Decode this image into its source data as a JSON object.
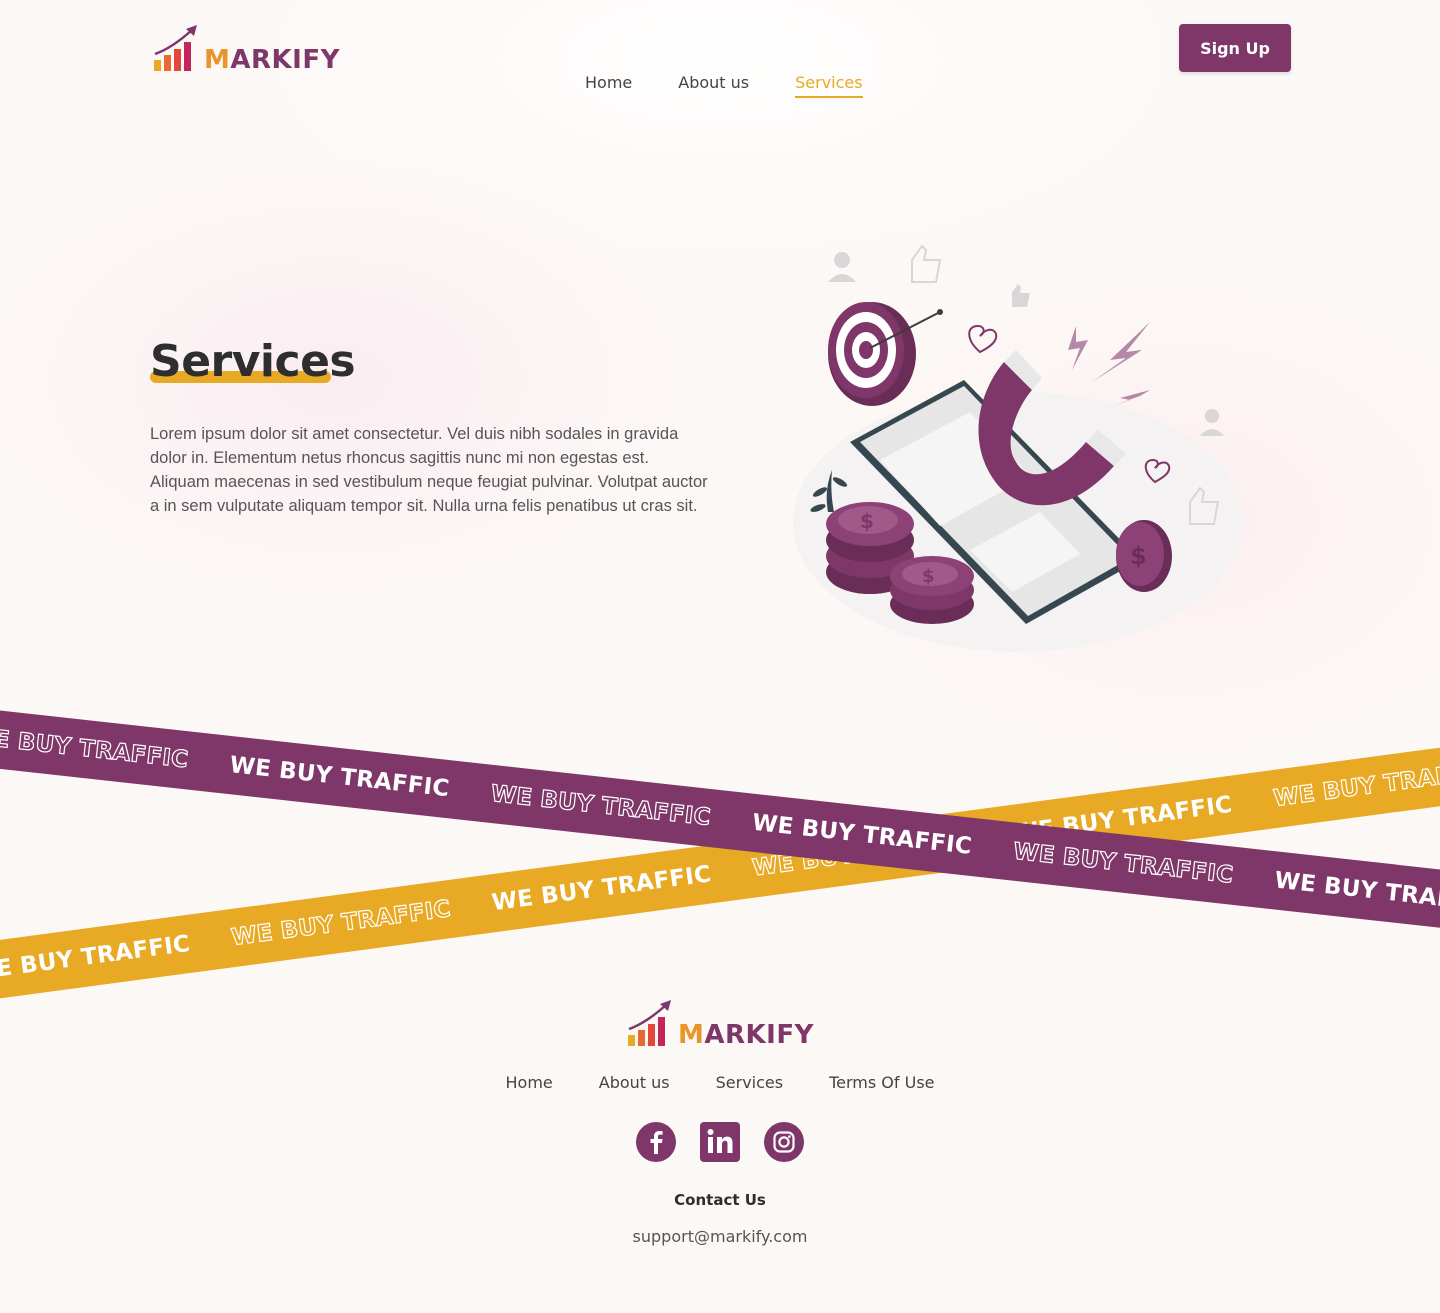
{
  "brand": {
    "name_first": "M",
    "name_rest": "ARKIFY"
  },
  "header": {
    "nav": [
      {
        "label": "Home"
      },
      {
        "label": "About us"
      },
      {
        "label": "Services",
        "active": true
      }
    ],
    "signup_label": "Sign Up"
  },
  "hero": {
    "title": "Services",
    "description": "Lorem ipsum dolor sit amet consectetur. Vel duis nibh sodales in gravida dolor in. Elementum netus rhoncus sagittis nunc mi non egestas est. Aliquam maecenas in sed vestibulum neque feugiat pulvinar. Volutpat auctor a in sem vulputate aliquam tempor sit. Nulla urna felis penatibus ut cras sit.",
    "illustration": "magnet-attracting-coins-phone-illustration"
  },
  "ribbons": {
    "text": "WE BUY TRAFFIC"
  },
  "footer": {
    "nav": [
      {
        "label": "Home"
      },
      {
        "label": "About us"
      },
      {
        "label": "Services"
      },
      {
        "label": "Terms Of Use"
      }
    ],
    "socials": [
      "facebook-icon",
      "linkedin-icon",
      "instagram-icon"
    ],
    "contact_title": "Contact Us",
    "email": "support@markify.com"
  },
  "colors": {
    "primary": "#7e3768",
    "accent": "#e8a925",
    "text": "#3c3c3c"
  }
}
